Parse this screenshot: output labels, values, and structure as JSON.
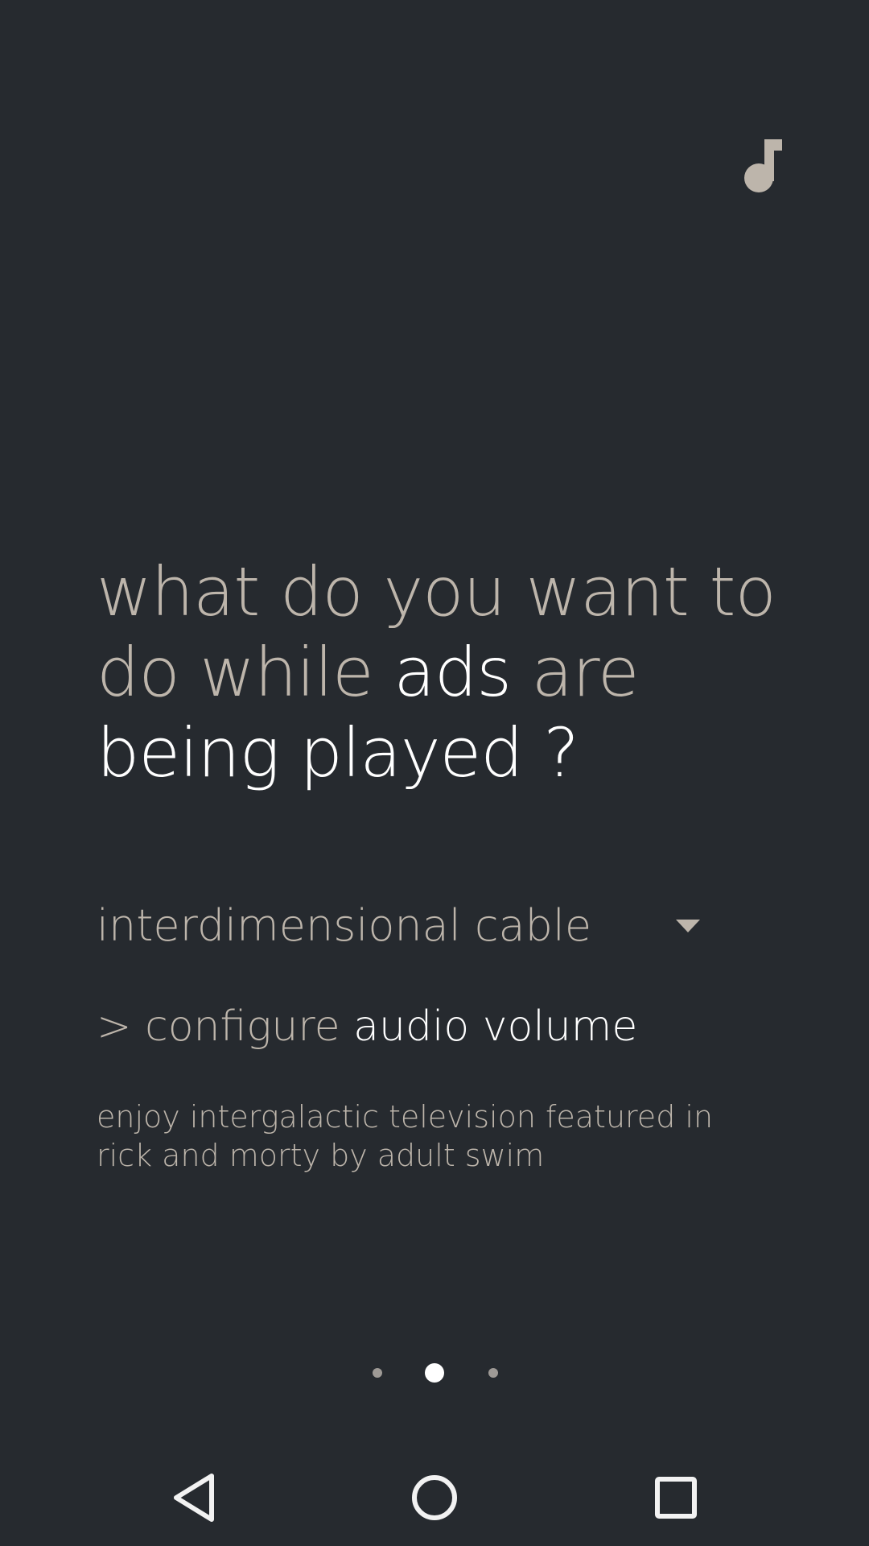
{
  "headline": {
    "part1": "what do you want to do while ",
    "part2": "ads",
    "part3": " are ",
    "part4": "being played ?"
  },
  "dropdown": {
    "selected": "interdimensional cable"
  },
  "configure": {
    "prefix": "> configure ",
    "target": "audio volume"
  },
  "description": "enjoy intergalactic television featured in rick and morty by adult swim",
  "pager": {
    "count": 3,
    "active_index": 1
  },
  "icons": {
    "music": "music-note-icon",
    "dropdown": "triangle-down-icon",
    "back": "nav-back-icon",
    "home": "nav-home-icon",
    "recents": "nav-recents-icon"
  },
  "colors": {
    "background": "#262a2f",
    "text_dim": "#bdb5ab",
    "text_bright": "#ffffff"
  }
}
